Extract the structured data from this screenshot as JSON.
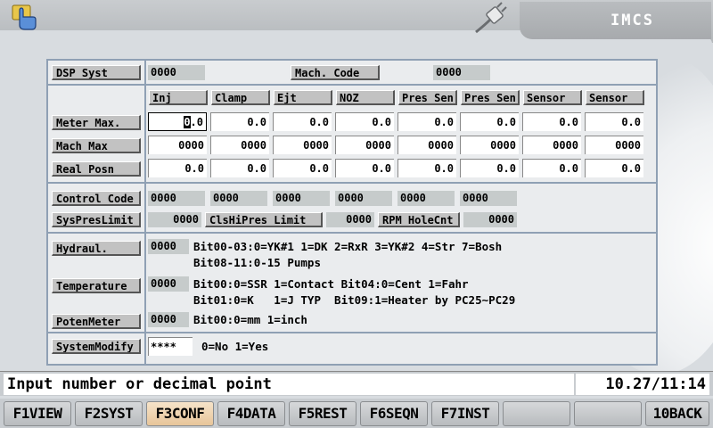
{
  "header": {
    "title": "IMCS"
  },
  "dsp": {
    "label": "DSP Syst",
    "value": "0000",
    "mach_code_label": "Mach. Code",
    "mach_code_value": "0000"
  },
  "meter": {
    "columns": [
      "Inj",
      "Clamp",
      "Ejt",
      "NOZ",
      "Pres Sen",
      "Pres Sen",
      "Sensor",
      "Sensor"
    ],
    "rows": [
      {
        "label": "Meter Max.",
        "cells": [
          "0.0",
          "0.0",
          "0.0",
          "0.0",
          "0.0",
          "0.0",
          "0.0",
          "0.0"
        ]
      },
      {
        "label": "Mach Max",
        "cells": [
          "0000",
          "0000",
          "0000",
          "0000",
          "0000",
          "0000",
          "0000",
          "0000"
        ]
      },
      {
        "label": "Real Posn",
        "cells": [
          "0.0",
          "0.0",
          "0.0",
          "0.0",
          "0.0",
          "0.0",
          "0.0",
          "0.0"
        ]
      }
    ],
    "active_cursor_char": "0",
    "active_rest": ".0"
  },
  "control": {
    "label": "Control Code",
    "values": [
      "0000",
      "0000",
      "0000",
      "0000",
      "0000",
      "0000"
    ],
    "syspres_label": "SysPresLimit",
    "syspres_value": "0000",
    "clshi_label": "ClsHiPres Limit",
    "clshi_value": "0000",
    "rpm_label": "RPM HoleCnt",
    "rpm_value": "0000"
  },
  "hydraul": {
    "label": "Hydraul.",
    "value": "0000",
    "desc1": "Bit00-03:0=YK#1 1=DK 2=RxR 3=YK#2 4=Str 7=Bosh",
    "desc2": "Bit08-11:0-15 Pumps"
  },
  "temperature": {
    "label": "Temperature",
    "value": "0000",
    "desc1": "Bit00:0=SSR 1=Contact Bit04:0=Cent 1=Fahr",
    "desc2": "Bit01:0=K   1=J TYP  Bit09:1=Heater by PC25~PC29"
  },
  "poten": {
    "label": "PotenMeter",
    "value": "0000",
    "desc": "Bit00:0=mm 1=inch"
  },
  "sysmod": {
    "label": "SystemModify",
    "value": "****",
    "desc": "0=No 1=Yes"
  },
  "status": {
    "message": "Input number or decimal point",
    "time": "10.27/11:14"
  },
  "fkeys": [
    "F1VIEW",
    "F2SYST",
    "F3CONF",
    "F4DATA",
    "F5REST",
    "F6SEQN",
    "F7INST",
    "",
    "",
    "10BACK"
  ],
  "colors": {
    "accent_active_key": "#e7c59a",
    "panel_border": "#8fa0b4"
  }
}
